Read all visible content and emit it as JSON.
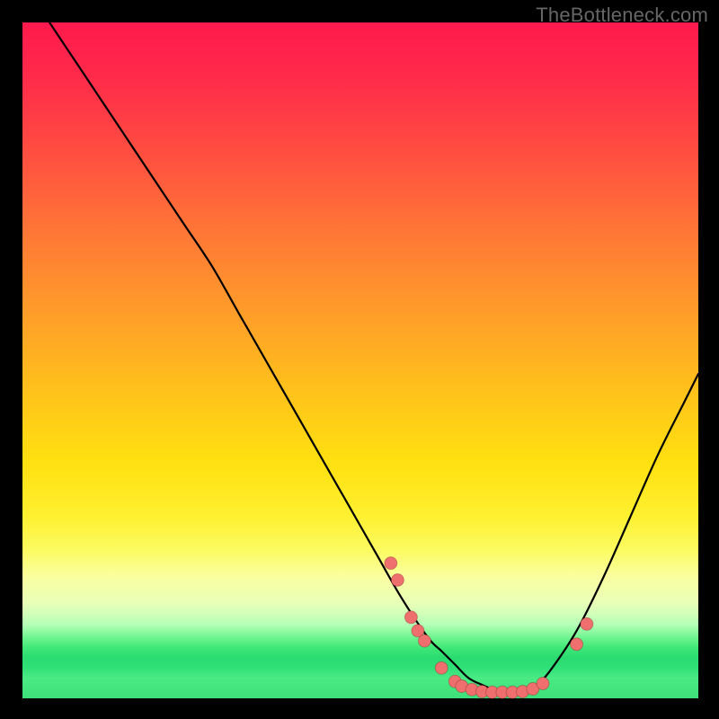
{
  "watermark": "TheBottleneck.com",
  "chart_data": {
    "type": "line",
    "title": "",
    "xlabel": "",
    "ylabel": "",
    "xlim": [
      0,
      100
    ],
    "ylim": [
      0,
      100
    ],
    "background_gradient": {
      "top": "#ff1a4d",
      "upper_mid": "#ffa028",
      "mid": "#ffe010",
      "lower_mid": "#faffa0",
      "bottom": "#3ee07a"
    },
    "series": [
      {
        "name": "bottleneck-curve",
        "x": [
          4,
          8,
          12,
          16,
          20,
          24,
          28,
          32,
          36,
          40,
          44,
          48,
          52,
          56,
          60,
          62,
          64,
          66,
          68,
          70,
          72,
          74,
          76,
          78,
          82,
          86,
          90,
          94,
          98,
          100
        ],
        "y": [
          100,
          94,
          88,
          82,
          76,
          70,
          64,
          57,
          50,
          43,
          36,
          29,
          22,
          15,
          9,
          7,
          5,
          3,
          2,
          1.2,
          1,
          1.2,
          2,
          4,
          10,
          18,
          27,
          36,
          44,
          48
        ]
      }
    ],
    "scatter_points": {
      "name": "highlighted-points",
      "points": [
        {
          "x": 54.5,
          "y": 20
        },
        {
          "x": 55.5,
          "y": 17.5
        },
        {
          "x": 57.5,
          "y": 12
        },
        {
          "x": 58.5,
          "y": 10
        },
        {
          "x": 59.5,
          "y": 8.5
        },
        {
          "x": 62.0,
          "y": 4.5
        },
        {
          "x": 64.0,
          "y": 2.5
        },
        {
          "x": 65.0,
          "y": 1.8
        },
        {
          "x": 66.5,
          "y": 1.3
        },
        {
          "x": 68.0,
          "y": 1.0
        },
        {
          "x": 69.5,
          "y": 0.9
        },
        {
          "x": 71.0,
          "y": 0.9
        },
        {
          "x": 72.5,
          "y": 0.9
        },
        {
          "x": 74.0,
          "y": 1.0
        },
        {
          "x": 75.5,
          "y": 1.4
        },
        {
          "x": 77.0,
          "y": 2.2
        },
        {
          "x": 82.0,
          "y": 8.0
        },
        {
          "x": 83.5,
          "y": 11.0
        }
      ],
      "color": "#ef6e6e",
      "radius_px": 7
    }
  }
}
